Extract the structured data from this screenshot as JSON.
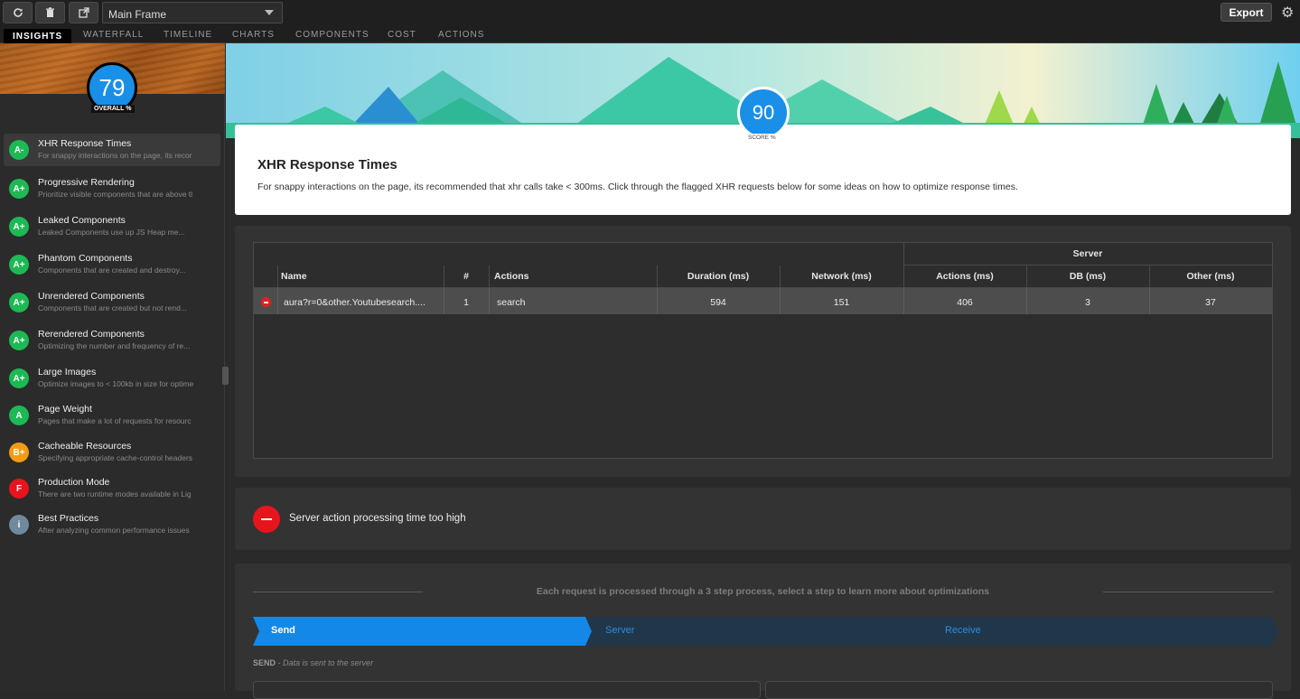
{
  "toolbar": {
    "refresh_icon": "refresh-icon",
    "trash_icon": "trash-icon",
    "popout_icon": "external-link-icon",
    "frame_select_value": "Main Frame",
    "export_label": "Export"
  },
  "tabs": [
    "INSIGHTS",
    "WATERFALL",
    "TIMELINE",
    "CHARTS",
    "COMPONENTS",
    "COST",
    "ACTIONS"
  ],
  "sidebar": {
    "overall_score": "79",
    "overall_label": "OVERALL %",
    "items": [
      {
        "grade": "A-",
        "title": "XHR Response Times",
        "desc": "For snappy interactions on the page, its recor",
        "color": "#1db954"
      },
      {
        "grade": "A+",
        "title": "Progressive Rendering",
        "desc": "Prioritize visible components that are above tl",
        "color": "#1db954"
      },
      {
        "grade": "A+",
        "title": "Leaked Components",
        "desc": "Leaked Components use up JS Heap me...",
        "color": "#1db954"
      },
      {
        "grade": "A+",
        "title": "Phantom Components",
        "desc": "Components that are created and destroy...",
        "color": "#1db954"
      },
      {
        "grade": "A+",
        "title": "Unrendered Components",
        "desc": "Components that are created but not rend...",
        "color": "#1db954"
      },
      {
        "grade": "A+",
        "title": "Rerendered Components",
        "desc": "Optimizing the number and frequency of re...",
        "color": "#1db954"
      },
      {
        "grade": "A+",
        "title": "Large Images",
        "desc": "Optimize images to < 100kb in size for optime",
        "color": "#1db954"
      },
      {
        "grade": "A",
        "title": "Page Weight",
        "desc": "Pages that make a lot of requests for resourc",
        "color": "#1db954"
      },
      {
        "grade": "B+",
        "title": "Cacheable Resources",
        "desc": "Specifying appropriate cache-control headers",
        "color": "#f39c12"
      },
      {
        "grade": "F",
        "title": "Production Mode",
        "desc": "There are two runtime modes available in Lig",
        "color": "#e8141c"
      },
      {
        "grade": "i",
        "title": "Best Practices",
        "desc": "After analyzing common performance issues",
        "color": "#6f8a9c"
      }
    ]
  },
  "main": {
    "score": "90",
    "score_label": "SCORE %",
    "title": "XHR Response Times",
    "description": "For snappy interactions on the page, its recommended that xhr calls take < 300ms. Click through the flagged XHR requests below for some ideas on how to optimize response times."
  },
  "table": {
    "group_header": "Server",
    "headers": [
      "Name",
      "#",
      "Actions",
      "Duration (ms)",
      "Network (ms)",
      "Actions (ms)",
      "DB (ms)",
      "Other (ms)"
    ],
    "rows": [
      [
        "aura?r=0&other.Youtubesearch....",
        "1",
        "search",
        "594",
        "151",
        "406",
        "3",
        "37"
      ]
    ]
  },
  "alert": {
    "text": "Server action processing time too high"
  },
  "steps": {
    "caption": "Each request is processed through a 3 step process, select a step to learn more about optimizations",
    "items": [
      "Send",
      "Server",
      "Receive"
    ],
    "send_caption_label": "SEND",
    "send_caption_text": " - Data is sent to the server"
  }
}
